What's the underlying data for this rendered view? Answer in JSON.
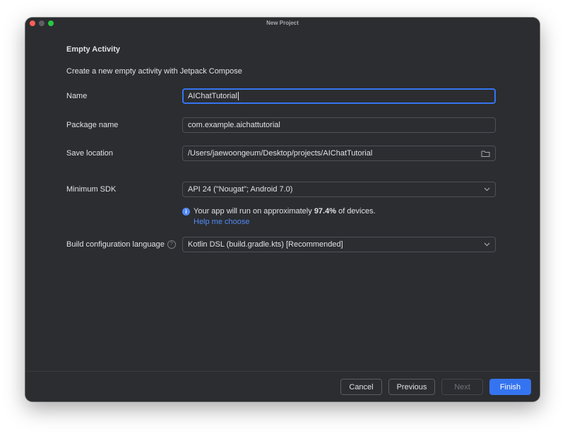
{
  "window": {
    "title": "New Project"
  },
  "header": {
    "section_title": "Empty Activity",
    "subtitle": "Create a new empty activity with Jetpack Compose"
  },
  "form": {
    "name": {
      "label": "Name",
      "value": "AIChatTutorial"
    },
    "package_name": {
      "label": "Package name",
      "value": "com.example.aichattutorial"
    },
    "save_location": {
      "label": "Save location",
      "value": "/Users/jaewoongeum/Desktop/projects/AIChatTutorial"
    },
    "minimum_sdk": {
      "label": "Minimum SDK",
      "value": "API 24 (\"Nougat\"; Android 7.0)"
    },
    "sdk_info": {
      "prefix": "Your app will run on approximately ",
      "percent": "97.4%",
      "suffix": " of devices.",
      "help_link": "Help me choose"
    },
    "build_language": {
      "label": "Build configuration language",
      "value": "Kotlin DSL (build.gradle.kts) [Recommended]"
    }
  },
  "footer": {
    "cancel": "Cancel",
    "previous": "Previous",
    "next": "Next",
    "finish": "Finish"
  },
  "colors": {
    "accent": "#3574f0",
    "link": "#548af7",
    "background": "#2b2d30"
  }
}
